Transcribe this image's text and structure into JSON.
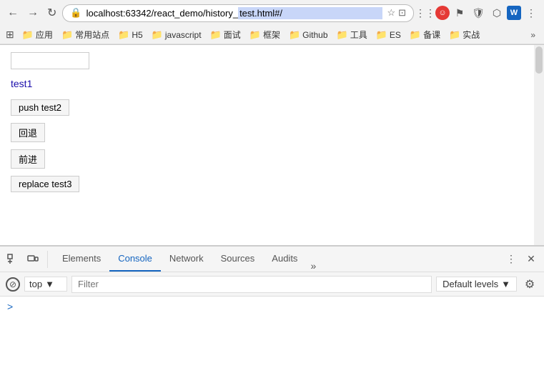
{
  "browser": {
    "back_btn": "←",
    "forward_btn": "→",
    "reload_btn": "↻",
    "address": "localhost:63342/react_demo/history_test.html#/",
    "address_prefix": "localhost:63342/react_demo/history_",
    "address_highlighted": "test.html#/",
    "bookmark_apps_icon": "⊞",
    "bookmarks": [
      {
        "label": "应用",
        "has_folder": false
      },
      {
        "label": "常用站点",
        "has_folder": true
      },
      {
        "label": "H5",
        "has_folder": true
      },
      {
        "label": "javascript",
        "has_folder": true
      },
      {
        "label": "面试",
        "has_folder": true
      },
      {
        "label": "框架",
        "has_folder": true
      },
      {
        "label": "Github",
        "has_folder": true
      },
      {
        "label": "工具",
        "has_folder": true
      },
      {
        "label": "ES",
        "has_folder": true
      },
      {
        "label": "备课",
        "has_folder": true
      },
      {
        "label": "实战",
        "has_folder": true
      }
    ],
    "more_bookmarks": "»"
  },
  "page": {
    "search_placeholder": "",
    "link_text": "test1",
    "push_btn": "push test2",
    "back_btn": "回退",
    "forward_btn": "前进",
    "replace_btn": "replace test3"
  },
  "devtools": {
    "tabs": [
      {
        "label": "Elements",
        "active": false
      },
      {
        "label": "Console",
        "active": true
      },
      {
        "label": "Network",
        "active": false
      },
      {
        "label": "Sources",
        "active": false
      },
      {
        "label": "Audits",
        "active": false
      }
    ],
    "more_tabs": "»",
    "toolbar": {
      "no_symbol": "⊘",
      "context": "top",
      "context_arrow": "▼",
      "filter_placeholder": "Filter",
      "levels": "Default levels",
      "levels_arrow": "▼",
      "gear_icon": "⚙"
    },
    "console_caret": ">"
  }
}
